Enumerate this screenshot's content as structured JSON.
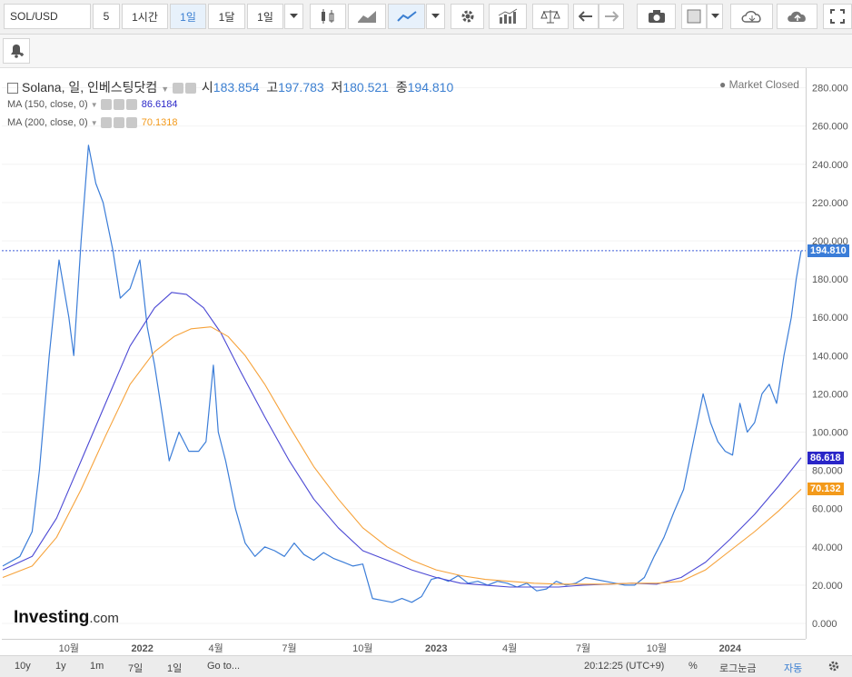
{
  "toolbar": {
    "symbol": "SOL/USD",
    "intervals": [
      "5",
      "1시간",
      "1일",
      "1달",
      "1일"
    ],
    "active_interval_index": 2,
    "icons": [
      "candles-icon",
      "area-chart-icon",
      "line-chart-icon",
      "dropdown-icon",
      "settings-gear-icon",
      "indicators-icon",
      "scales-icon",
      "undo-icon",
      "redo-icon",
      "camera-icon",
      "color-square-icon",
      "cloud-download-icon",
      "cloud-upload-icon",
      "fullscreen-icon"
    ]
  },
  "legend": {
    "title": "Solana, 일, 인베스팅닷컴",
    "open_label": "시",
    "open": "183.854",
    "high_label": "고",
    "high": "197.783",
    "low_label": "저",
    "low": "180.521",
    "close_label": "종",
    "close": "194.810",
    "market_status": "Market Closed",
    "ma150_label": "MA (150, close, 0)",
    "ma150_value": "86.6184",
    "ma200_label": "MA (200, close, 0)",
    "ma200_value": "70.1318"
  },
  "price_tags": {
    "last": "194.810",
    "ma150": "86.618",
    "ma200": "70.132"
  },
  "colors": {
    "price": "#3b7dd8",
    "ma150": "#4b48d4",
    "ma200": "#f6a23a",
    "last_tag": "#3b7dd8",
    "ma150_tag": "#2a26c8",
    "ma200_tag": "#f39a1b"
  },
  "watermark": {
    "brand": "Investing",
    "suffix": ".com"
  },
  "bottom_bar": {
    "ranges": [
      "10y",
      "1y",
      "1m",
      "7일",
      "1일"
    ],
    "goto": "Go to...",
    "time": "20:12:25 (UTC+9)",
    "percent": "%",
    "log": "로그눈금",
    "auto": "자동"
  },
  "chart_data": {
    "type": "line",
    "ylim": [
      -5,
      290
    ],
    "y_ticks": [
      "0.000",
      "20.000",
      "40.000",
      "60.000",
      "80.000",
      "100.000",
      "120.000",
      "140.000",
      "160.000",
      "180.000",
      "200.000",
      "220.000",
      "240.000",
      "260.000",
      "280.000"
    ],
    "x_ticks": [
      "10월",
      "2022",
      "4월",
      "7월",
      "10월",
      "2023",
      "4월",
      "7월",
      "10월",
      "2024"
    ],
    "x_tick_months": [
      9,
      12,
      15,
      18,
      21,
      24,
      27,
      30,
      33,
      36
    ],
    "x_start_month": 6.3,
    "x_end_month": 38.9,
    "series": [
      {
        "name": "Solana",
        "x": [
          6.3,
          7.0,
          7.5,
          7.8,
          8.2,
          8.6,
          9.0,
          9.2,
          9.5,
          9.8,
          10.1,
          10.4,
          10.8,
          11.1,
          11.5,
          11.9,
          12.2,
          12.5,
          12.8,
          13.1,
          13.5,
          13.9,
          14.3,
          14.6,
          14.9,
          15.1,
          15.4,
          15.8,
          16.2,
          16.6,
          17.0,
          17.4,
          17.8,
          18.2,
          18.6,
          19.0,
          19.4,
          19.8,
          20.2,
          20.6,
          21.0,
          21.4,
          21.8,
          22.2,
          22.6,
          23.0,
          23.4,
          23.8,
          24.1,
          24.5,
          24.9,
          25.3,
          25.7,
          26.1,
          26.5,
          26.9,
          27.3,
          27.7,
          28.1,
          28.5,
          28.9,
          29.3,
          29.7,
          30.1,
          30.5,
          30.9,
          31.3,
          31.7,
          32.1,
          32.5,
          32.9,
          33.3,
          33.7,
          34.1,
          34.5,
          34.9,
          35.2,
          35.5,
          35.8,
          36.1,
          36.4,
          36.7,
          37.0,
          37.3,
          37.6,
          37.9,
          38.2,
          38.5,
          38.7,
          38.9
        ],
        "values": [
          30,
          35,
          48,
          80,
          140,
          190,
          160,
          140,
          200,
          250,
          230,
          220,
          195,
          170,
          175,
          190,
          155,
          135,
          110,
          85,
          100,
          90,
          90,
          95,
          135,
          100,
          85,
          60,
          42,
          35,
          40,
          38,
          35,
          42,
          36,
          33,
          37,
          34,
          32,
          30,
          31,
          13,
          12,
          11,
          13,
          11,
          14,
          23,
          24,
          22,
          25,
          21,
          22,
          20,
          22,
          21,
          19,
          21,
          17,
          18,
          22,
          20,
          21,
          24,
          23,
          22,
          21,
          20,
          20,
          24,
          35,
          45,
          58,
          70,
          95,
          120,
          105,
          95,
          90,
          88,
          115,
          100,
          105,
          120,
          125,
          115,
          140,
          160,
          180,
          194.8
        ]
      },
      {
        "name": "MA (150, close, 0)",
        "x": [
          6.3,
          7.5,
          8.5,
          9.5,
          10.5,
          11.5,
          12.5,
          13.2,
          13.8,
          14.5,
          15.2,
          16.0,
          17.0,
          18.0,
          19.0,
          20.0,
          21.0,
          22.0,
          23.0,
          24.0,
          25.0,
          26.0,
          27.0,
          28.0,
          29.0,
          30.0,
          31.0,
          32.0,
          33.0,
          34.0,
          35.0,
          36.0,
          37.0,
          38.0,
          38.9
        ],
        "values": [
          28,
          35,
          55,
          85,
          115,
          145,
          165,
          173,
          172,
          165,
          152,
          132,
          108,
          85,
          65,
          50,
          38,
          33,
          28,
          24,
          21,
          20,
          19,
          19,
          19,
          20,
          20.5,
          21,
          20.5,
          24,
          32,
          44,
          57,
          72,
          86.6
        ]
      },
      {
        "name": "MA (200, close, 0)",
        "x": [
          6.3,
          7.5,
          8.5,
          9.5,
          10.5,
          11.5,
          12.5,
          13.3,
          14.0,
          14.8,
          15.5,
          16.2,
          17.0,
          18.0,
          19.0,
          20.0,
          21.0,
          22.0,
          23.0,
          24.0,
          25.0,
          26.0,
          27.0,
          28.0,
          29.0,
          30.0,
          31.0,
          32.0,
          33.0,
          34.0,
          35.0,
          36.0,
          37.0,
          38.0,
          38.9
        ],
        "values": [
          24,
          30,
          45,
          70,
          98,
          125,
          142,
          150,
          154,
          155,
          150,
          140,
          125,
          103,
          82,
          65,
          50,
          40,
          33,
          28,
          25,
          23,
          22,
          21,
          20.5,
          20.5,
          20.5,
          21,
          21,
          22,
          28,
          38,
          48,
          59,
          70.1
        ]
      }
    ]
  }
}
